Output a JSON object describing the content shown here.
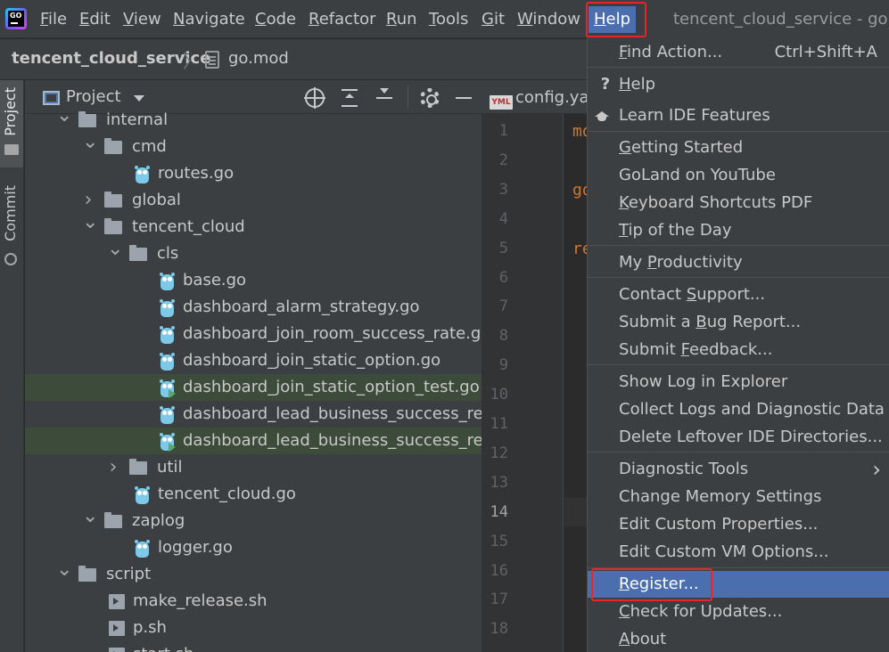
{
  "menubar": {
    "items": [
      "File",
      "Edit",
      "View",
      "Navigate",
      "Code",
      "Refactor",
      "Run",
      "Tools",
      "Git",
      "Window",
      "Help"
    ],
    "active": "Help",
    "window_title": "tencent_cloud_service - go.m",
    "logo_text": "GO"
  },
  "breadcrumb": {
    "project": "tencent_cloud_service",
    "separator": "〉",
    "file": "go.mod"
  },
  "tool_strip": {
    "project_tab": "Project",
    "commit_tab": "Commit"
  },
  "project_panel": {
    "title": "Project",
    "tree": [
      {
        "name": "internal",
        "type": "folder",
        "expanded": true,
        "depth": 2
      },
      {
        "name": "cmd",
        "type": "folder",
        "expanded": true,
        "depth": 3
      },
      {
        "name": "routes.go",
        "type": "go",
        "depth": 4
      },
      {
        "name": "global",
        "type": "folder",
        "expanded": false,
        "depth": 3
      },
      {
        "name": "tencent_cloud",
        "type": "folder",
        "expanded": true,
        "depth": 3
      },
      {
        "name": "cls",
        "type": "folder",
        "expanded": true,
        "depth": 4
      },
      {
        "name": "base.go",
        "type": "go",
        "depth": 5
      },
      {
        "name": "dashboard_alarm_strategy.go",
        "type": "go",
        "depth": 5
      },
      {
        "name": "dashboard_join_room_success_rate.go",
        "type": "go",
        "depth": 5
      },
      {
        "name": "dashboard_join_static_option.go",
        "type": "go",
        "depth": 5
      },
      {
        "name": "dashboard_join_static_option_test.go",
        "type": "gotest",
        "depth": 5,
        "selected": true
      },
      {
        "name": "dashboard_lead_business_success_reate",
        "type": "go",
        "depth": 5
      },
      {
        "name": "dashboard_lead_business_success_reate",
        "type": "gotest",
        "depth": 5,
        "selected": true
      },
      {
        "name": "util",
        "type": "folder",
        "expanded": false,
        "depth": 4
      },
      {
        "name": "tencent_cloud.go",
        "type": "go",
        "depth": 4
      },
      {
        "name": "zaplog",
        "type": "folder",
        "expanded": true,
        "depth": 3
      },
      {
        "name": "logger.go",
        "type": "go",
        "depth": 4
      },
      {
        "name": "script",
        "type": "folder",
        "expanded": true,
        "depth": 2
      },
      {
        "name": "make_release.sh",
        "type": "sh",
        "depth": 3
      },
      {
        "name": "p.sh",
        "type": "sh",
        "depth": 3
      },
      {
        "name": "start.sh",
        "type": "sh",
        "depth": 3
      }
    ]
  },
  "editor": {
    "tab_label": "config.yaml",
    "tab_icon_text": "YML",
    "current_line": 14,
    "line_numbers": [
      1,
      2,
      3,
      4,
      5,
      6,
      7,
      8,
      9,
      10,
      11,
      12,
      13,
      14,
      15,
      16,
      17,
      18
    ],
    "code_fragments": [
      {
        "line": 1,
        "text": "mo"
      },
      {
        "line": 3,
        "text": "go"
      },
      {
        "line": 5,
        "text": "re"
      }
    ]
  },
  "help_menu": {
    "groups": [
      [
        {
          "label": "Find Action...",
          "u": "F",
          "shortcut": "Ctrl+Shift+A"
        }
      ],
      [
        {
          "label": "Help",
          "u": "H",
          "icon": "?"
        },
        {
          "label": "Learn IDE Features",
          "icon": "cap"
        }
      ],
      [
        {
          "label": "Getting Started",
          "u": "G"
        },
        {
          "label": "GoLand on YouTube"
        },
        {
          "label": "Keyboard Shortcuts PDF",
          "u": "K"
        },
        {
          "label": "Tip of the Day",
          "u": "T"
        }
      ],
      [
        {
          "label": "My Productivity",
          "u": "P"
        }
      ],
      [
        {
          "label": "Contact Support...",
          "u": "S"
        },
        {
          "label": "Submit a Bug Report...",
          "u": "B"
        },
        {
          "label": "Submit Feedback...",
          "u": "F"
        }
      ],
      [
        {
          "label": "Show Log in Explorer"
        },
        {
          "label": "Collect Logs and Diagnostic Data"
        },
        {
          "label": "Delete Leftover IDE Directories..."
        }
      ],
      [
        {
          "label": "Diagnostic Tools",
          "submenu": true
        },
        {
          "label": "Change Memory Settings"
        },
        {
          "label": "Edit Custom Properties..."
        },
        {
          "label": "Edit Custom VM Options..."
        }
      ],
      [
        {
          "label": "Register...",
          "u": "R",
          "highlighted": true
        },
        {
          "label": "Check for Updates...",
          "u": "C"
        },
        {
          "label": "About",
          "u": "A"
        }
      ]
    ]
  },
  "colors": {
    "menu_bg": "#3c3f41",
    "highlight": "#4b6eaf",
    "annotation_red": "#e8262a",
    "selected_row": "#3d4b3a"
  }
}
